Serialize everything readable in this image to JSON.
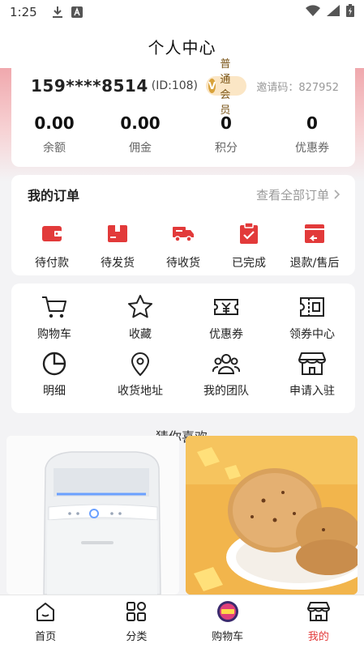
{
  "status_bar": {
    "time": "1:25"
  },
  "header": {
    "title": "个人中心"
  },
  "profile": {
    "phone": "159****8514",
    "user_id": "(ID:108)",
    "member_level": "普通会员",
    "invite_code": "邀请码：827952",
    "stats": [
      {
        "value": "0.00",
        "label": "余额"
      },
      {
        "value": "0.00",
        "label": "佣金"
      },
      {
        "value": "0",
        "label": "积分"
      },
      {
        "value": "0",
        "label": "优惠券"
      }
    ]
  },
  "orders": {
    "title": "我的订单",
    "view_all": "查看全部订单",
    "items": [
      {
        "label": "待付款",
        "icon": "wallet-icon"
      },
      {
        "label": "待发货",
        "icon": "box-icon"
      },
      {
        "label": "待收货",
        "icon": "truck-icon"
      },
      {
        "label": "已完成",
        "icon": "clipboard-check-icon"
      },
      {
        "label": "退款/售后",
        "icon": "refund-icon"
      }
    ]
  },
  "tools": [
    {
      "label": "购物车",
      "icon": "cart-icon"
    },
    {
      "label": "收藏",
      "icon": "star-icon"
    },
    {
      "label": "优惠券",
      "icon": "coupon-icon"
    },
    {
      "label": "领券中心",
      "icon": "ticket-icon"
    },
    {
      "label": "明细",
      "icon": "pie-chart-icon"
    },
    {
      "label": "收货地址",
      "icon": "location-icon"
    },
    {
      "label": "我的团队",
      "icon": "team-icon"
    },
    {
      "label": "申请入驻",
      "icon": "store-icon"
    }
  ],
  "guess": {
    "title": "猜你喜欢"
  },
  "bottom_nav": [
    {
      "label": "首页",
      "icon": "home-icon",
      "active": false
    },
    {
      "label": "分类",
      "icon": "category-icon",
      "active": false
    },
    {
      "label": "购物车",
      "icon": "cart-promo-icon",
      "active": false
    },
    {
      "label": "我的",
      "icon": "shop-icon",
      "active": true
    }
  ],
  "colors": {
    "accent": "#e23a3a",
    "badge_bg": "#fbe6c5",
    "badge_text": "#7a5518"
  }
}
